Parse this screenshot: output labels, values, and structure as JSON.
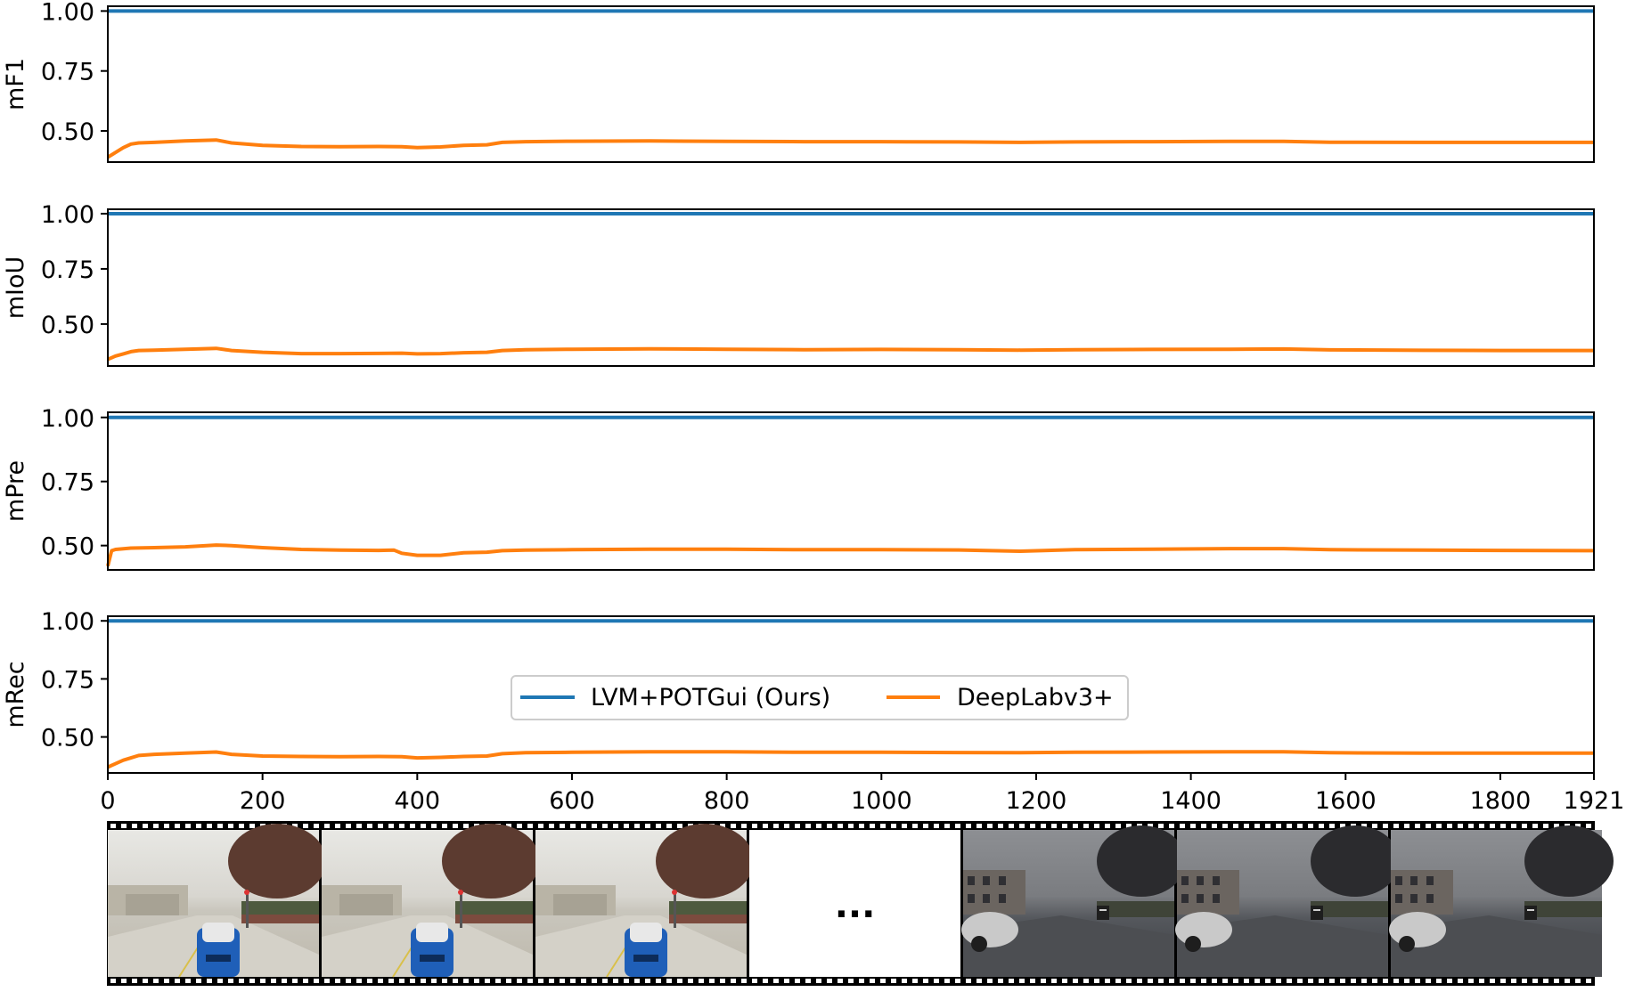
{
  "chart_data": [
    {
      "type": "line",
      "ylabel": "mF1",
      "xlim": [
        0,
        1921
      ],
      "ylim": [
        0.37,
        1.02
      ],
      "yticks": [
        0.5,
        0.75,
        1.0
      ],
      "ytick_labels": [
        "0.50",
        "0.75",
        "1.00"
      ],
      "x": [
        0,
        10,
        20,
        30,
        40,
        60,
        100,
        140,
        160,
        200,
        250,
        300,
        350,
        380,
        400,
        430,
        460,
        490,
        510,
        540,
        600,
        700,
        800,
        900,
        1000,
        1100,
        1180,
        1250,
        1350,
        1450,
        1520,
        1580,
        1700,
        1800,
        1921
      ],
      "series": [
        {
          "name": "LVM+POTGui (Ours)",
          "color": "#1f77b4",
          "values": [
            1.0,
            1.0,
            1.0,
            1.0,
            1.0,
            1.0,
            1.0,
            1.0,
            1.0,
            1.0,
            1.0,
            1.0,
            1.0,
            1.0,
            1.0,
            1.0,
            1.0,
            1.0,
            1.0,
            1.0,
            1.0,
            1.0,
            1.0,
            1.0,
            1.0,
            1.0,
            1.0,
            1.0,
            1.0,
            1.0,
            1.0,
            1.0,
            1.0,
            1.0,
            1.0
          ]
        },
        {
          "name": "DeepLabv3+",
          "color": "#ff7f0e",
          "values": [
            0.39,
            0.41,
            0.43,
            0.445,
            0.45,
            0.452,
            0.458,
            0.462,
            0.45,
            0.44,
            0.435,
            0.434,
            0.435,
            0.434,
            0.43,
            0.433,
            0.44,
            0.442,
            0.452,
            0.455,
            0.457,
            0.458,
            0.456,
            0.455,
            0.455,
            0.454,
            0.452,
            0.454,
            0.455,
            0.456,
            0.456,
            0.453,
            0.452,
            0.452,
            0.452
          ]
        }
      ]
    },
    {
      "type": "line",
      "ylabel": "mIoU",
      "xlim": [
        0,
        1921
      ],
      "ylim": [
        0.31,
        1.02
      ],
      "yticks": [
        0.5,
        0.75,
        1.0
      ],
      "ytick_labels": [
        "0.50",
        "0.75",
        "1.00"
      ],
      "x": [
        0,
        10,
        20,
        30,
        40,
        60,
        100,
        140,
        160,
        200,
        250,
        300,
        350,
        380,
        400,
        430,
        460,
        490,
        510,
        540,
        600,
        700,
        800,
        900,
        1000,
        1100,
        1180,
        1250,
        1350,
        1450,
        1520,
        1580,
        1700,
        1800,
        1921
      ],
      "series": [
        {
          "name": "LVM+POTGui (Ours)",
          "color": "#1f77b4",
          "values": [
            1.0,
            1.0,
            1.0,
            1.0,
            1.0,
            1.0,
            1.0,
            1.0,
            1.0,
            1.0,
            1.0,
            1.0,
            1.0,
            1.0,
            1.0,
            1.0,
            1.0,
            1.0,
            1.0,
            1.0,
            1.0,
            1.0,
            1.0,
            1.0,
            1.0,
            1.0,
            1.0,
            1.0,
            1.0,
            1.0,
            1.0,
            1.0,
            1.0,
            1.0,
            1.0
          ]
        },
        {
          "name": "DeepLabv3+",
          "color": "#ff7f0e",
          "values": [
            0.34,
            0.355,
            0.365,
            0.375,
            0.38,
            0.382,
            0.386,
            0.39,
            0.38,
            0.372,
            0.366,
            0.366,
            0.367,
            0.368,
            0.365,
            0.366,
            0.37,
            0.372,
            0.38,
            0.384,
            0.386,
            0.388,
            0.386,
            0.384,
            0.385,
            0.384,
            0.382,
            0.384,
            0.385,
            0.386,
            0.387,
            0.383,
            0.381,
            0.38,
            0.38
          ]
        }
      ]
    },
    {
      "type": "line",
      "ylabel": "mPre",
      "xlim": [
        0,
        1921
      ],
      "ylim": [
        0.405,
        1.02
      ],
      "yticks": [
        0.5,
        0.75,
        1.0
      ],
      "ytick_labels": [
        "0.50",
        "0.75",
        "1.00"
      ],
      "x": [
        0,
        5,
        10,
        30,
        60,
        100,
        140,
        160,
        200,
        250,
        300,
        350,
        370,
        380,
        400,
        430,
        460,
        490,
        510,
        540,
        600,
        700,
        800,
        900,
        1000,
        1100,
        1180,
        1250,
        1350,
        1450,
        1520,
        1580,
        1700,
        1800,
        1921
      ],
      "series": [
        {
          "name": "LVM+POTGui (Ours)",
          "color": "#1f77b4",
          "values": [
            1.0,
            1.0,
            1.0,
            1.0,
            1.0,
            1.0,
            1.0,
            1.0,
            1.0,
            1.0,
            1.0,
            1.0,
            1.0,
            1.0,
            1.0,
            1.0,
            1.0,
            1.0,
            1.0,
            1.0,
            1.0,
            1.0,
            1.0,
            1.0,
            1.0,
            1.0,
            1.0,
            1.0,
            1.0,
            1.0,
            1.0,
            1.0,
            1.0,
            1.0,
            1.0
          ]
        },
        {
          "name": "DeepLabv3+",
          "color": "#ff7f0e",
          "values": [
            0.42,
            0.48,
            0.485,
            0.49,
            0.492,
            0.495,
            0.502,
            0.5,
            0.492,
            0.485,
            0.482,
            0.481,
            0.482,
            0.47,
            0.462,
            0.462,
            0.472,
            0.474,
            0.48,
            0.482,
            0.484,
            0.486,
            0.486,
            0.484,
            0.484,
            0.483,
            0.478,
            0.484,
            0.486,
            0.488,
            0.488,
            0.484,
            0.482,
            0.481,
            0.48
          ]
        }
      ]
    },
    {
      "type": "line",
      "ylabel": "mRec",
      "xlim": [
        0,
        1921
      ],
      "ylim": [
        0.345,
        1.02
      ],
      "yticks": [
        0.5,
        0.75,
        1.0
      ],
      "ytick_labels": [
        "0.50",
        "0.75",
        "1.00"
      ],
      "xticks": [
        0,
        200,
        400,
        600,
        800,
        1000,
        1200,
        1400,
        1600,
        1800,
        1921
      ],
      "xtick_labels": [
        "0",
        "200",
        "400",
        "600",
        "800",
        "1000",
        "1200",
        "1400",
        "1600",
        "1800",
        "1921"
      ],
      "legend": {
        "entries": [
          "LVM+POTGui (Ours)",
          "DeepLabv3+"
        ],
        "placement": "center",
        "ncol": 2
      },
      "x": [
        0,
        10,
        20,
        30,
        40,
        60,
        100,
        140,
        160,
        200,
        250,
        300,
        350,
        380,
        400,
        430,
        460,
        490,
        510,
        540,
        600,
        700,
        800,
        900,
        1000,
        1100,
        1180,
        1250,
        1350,
        1450,
        1520,
        1580,
        1700,
        1800,
        1921
      ],
      "series": [
        {
          "name": "LVM+POTGui (Ours)",
          "color": "#1f77b4",
          "values": [
            1.0,
            1.0,
            1.0,
            1.0,
            1.0,
            1.0,
            1.0,
            1.0,
            1.0,
            1.0,
            1.0,
            1.0,
            1.0,
            1.0,
            1.0,
            1.0,
            1.0,
            1.0,
            1.0,
            1.0,
            1.0,
            1.0,
            1.0,
            1.0,
            1.0,
            1.0,
            1.0,
            1.0,
            1.0,
            1.0,
            1.0,
            1.0,
            1.0,
            1.0,
            1.0
          ]
        },
        {
          "name": "DeepLabv3+",
          "color": "#ff7f0e",
          "values": [
            0.37,
            0.385,
            0.4,
            0.41,
            0.42,
            0.425,
            0.43,
            0.435,
            0.425,
            0.418,
            0.416,
            0.415,
            0.416,
            0.415,
            0.41,
            0.412,
            0.416,
            0.418,
            0.428,
            0.432,
            0.434,
            0.436,
            0.436,
            0.434,
            0.434,
            0.433,
            0.432,
            0.434,
            0.435,
            0.436,
            0.436,
            0.432,
            0.43,
            0.43,
            0.43
          ]
        }
      ]
    }
  ],
  "filmstrip": {
    "ellipsis": "...",
    "frames_left": 3,
    "frames_right": 3
  }
}
